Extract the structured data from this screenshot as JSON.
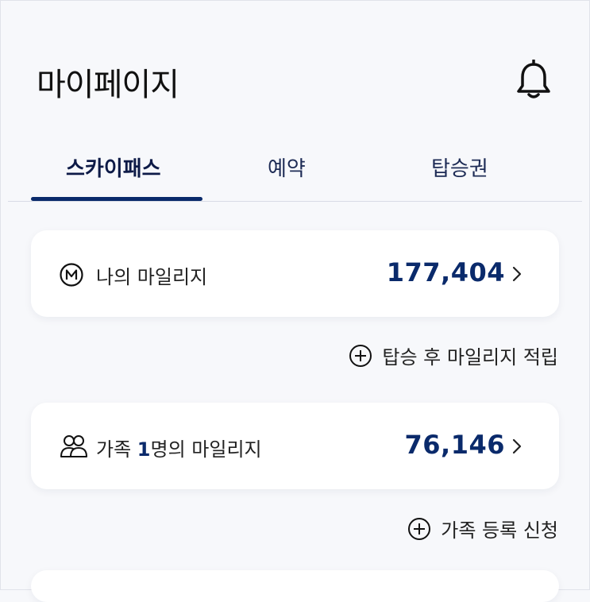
{
  "header": {
    "title": "마이페이지",
    "bell_icon": "bell-icon"
  },
  "tabs": [
    {
      "label": "스카이패스",
      "active": true
    },
    {
      "label": "예약",
      "active": false
    },
    {
      "label": "탑승권",
      "active": false
    }
  ],
  "mileage_card": {
    "icon": "mileage-m-icon",
    "label": "나의 마일리지",
    "value": "177,404"
  },
  "earn_action": {
    "icon": "plus-circle-icon",
    "label": "탑승 후 마일리지 적립"
  },
  "family_card": {
    "icon": "family-icon",
    "label_prefix": "가족 ",
    "count": "1",
    "label_suffix": "명의 마일리지",
    "value": "76,146"
  },
  "family_action": {
    "icon": "plus-circle-icon",
    "label": "가족 등록 신청"
  },
  "colors": {
    "accent": "#0a2a6b",
    "background": "#f7f8fb",
    "card": "#ffffff"
  }
}
